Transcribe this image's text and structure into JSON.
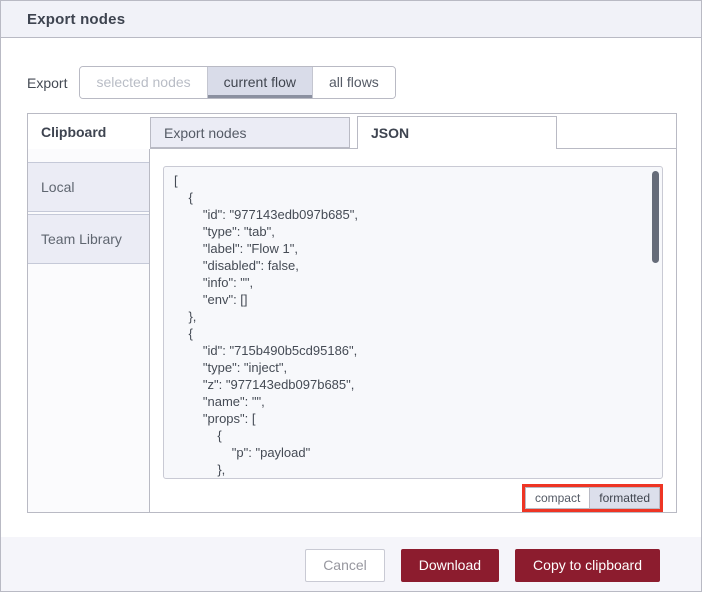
{
  "dialog": {
    "title": "Export nodes"
  },
  "export_row": {
    "label": "Export",
    "options": [
      {
        "label": "selected nodes",
        "state": "disabled"
      },
      {
        "label": "current flow",
        "state": "selected"
      },
      {
        "label": "all flows",
        "state": "normal"
      }
    ]
  },
  "tabs": {
    "clipboard_label": "Clipboard",
    "export_nodes_tab": "Export nodes",
    "json_tab": "JSON",
    "active_tab": "JSON"
  },
  "sidebar": {
    "items": [
      {
        "label": "Local"
      },
      {
        "label": "Team Library"
      }
    ]
  },
  "editor": {
    "json_text": "[\n    {\n        \"id\": \"977143edb097b685\",\n        \"type\": \"tab\",\n        \"label\": \"Flow 1\",\n        \"disabled\": false,\n        \"info\": \"\",\n        \"env\": []\n    },\n    {\n        \"id\": \"715b490b5cd95186\",\n        \"type\": \"inject\",\n        \"z\": \"977143edb097b685\",\n        \"name\": \"\",\n        \"props\": [\n            {\n                \"p\": \"payload\"\n            },"
  },
  "format_toggle": {
    "compact_label": "compact",
    "formatted_label": "formatted",
    "selected": "formatted",
    "annotation_color": "#ee3524"
  },
  "footer": {
    "cancel_label": "Cancel",
    "download_label": "Download",
    "copy_label": "Copy to clipboard",
    "accent_color": "#8c1c2e"
  }
}
